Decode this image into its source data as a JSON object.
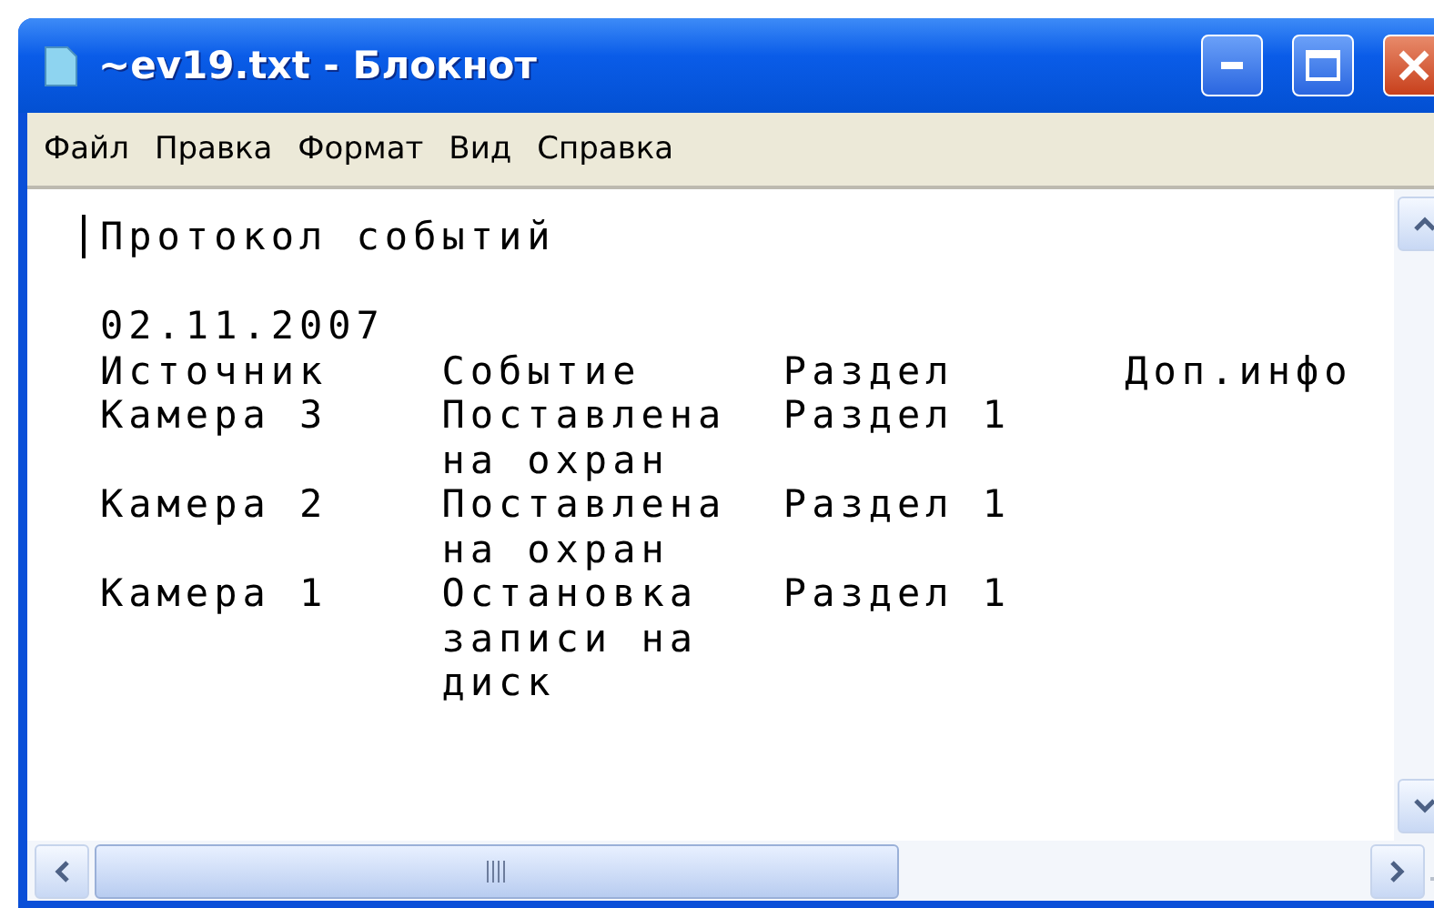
{
  "window": {
    "title": "~ev19.txt - Блокнот"
  },
  "menu": [
    "Файл",
    "Правка",
    "Формат",
    "Вид",
    "Справка"
  ],
  "document": {
    "heading": "Протокол событий",
    "date": "02.11.2007",
    "lines": [
      "Источник    Событие     Раздел      Доп.инфо",
      "Камера 3    Поставлена  Раздел 1",
      "            на охран",
      "Камера 2    Поставлена  Раздел 1",
      "            на охран",
      "Камера 1    Остановка   Раздел 1",
      "            записи на",
      "            диск"
    ]
  }
}
